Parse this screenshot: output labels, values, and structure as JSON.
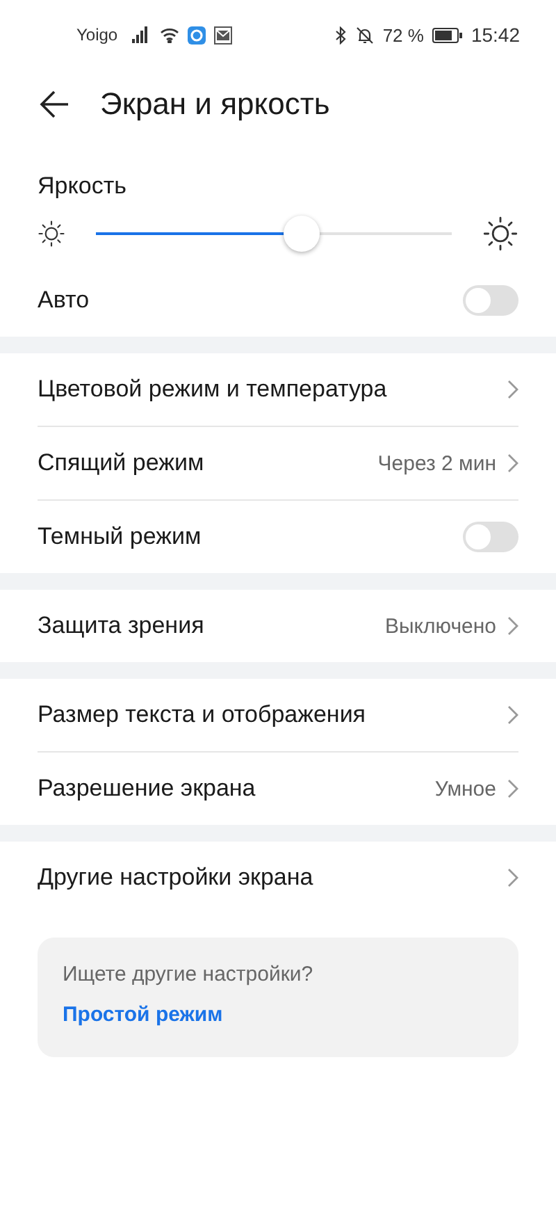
{
  "status_bar": {
    "carrier": "Yoigo",
    "battery": "72 %",
    "time": "15:42"
  },
  "header": {
    "title": "Экран и яркость"
  },
  "brightness": {
    "label": "Яркость",
    "level": 0.58
  },
  "sections": [
    {
      "items": [
        {
          "kind": "toggle",
          "label": "Авто",
          "on": false
        }
      ]
    },
    {
      "items": [
        {
          "kind": "link",
          "label": "Цветовой режим и температура"
        },
        {
          "kind": "link",
          "label": "Спящий режим",
          "value": "Через 2 мин"
        },
        {
          "kind": "toggle",
          "label": "Темный режим",
          "on": false
        }
      ]
    },
    {
      "items": [
        {
          "kind": "link",
          "label": "Защита зрения",
          "value": "Выключено"
        }
      ]
    },
    {
      "items": [
        {
          "kind": "link",
          "label": "Размер текста и отображения"
        },
        {
          "kind": "link",
          "label": "Разрешение экрана",
          "value": "Умное"
        }
      ]
    },
    {
      "items": [
        {
          "kind": "link",
          "label": "Другие настройки экрана"
        }
      ]
    }
  ],
  "hint_card": {
    "question": "Ищете другие настройки?",
    "link": "Простой режим"
  }
}
